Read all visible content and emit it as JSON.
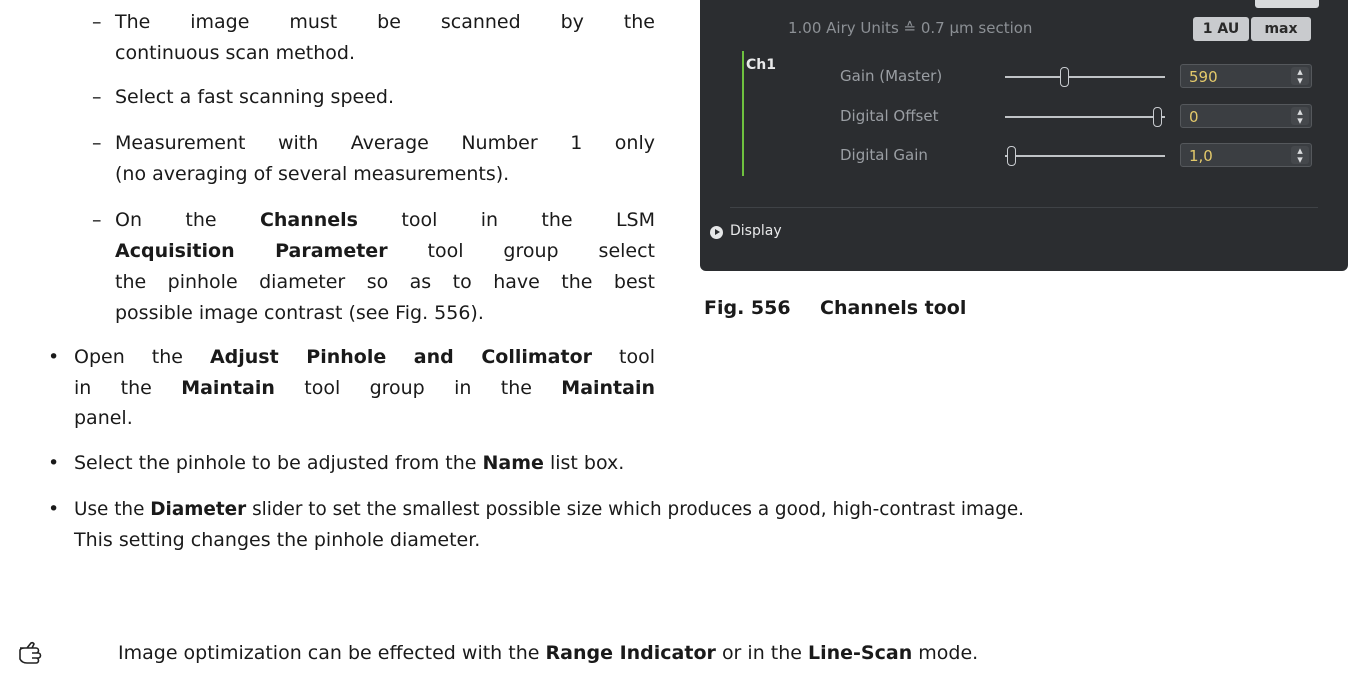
{
  "left_list": {
    "item1_line1": "The image must be scanned by the",
    "item1_line2": "continuous scan method.",
    "item2": "Select a fast scanning speed.",
    "item3_line1": "Measurement with Average Number 1 only",
    "item3_line2": "(no averaging of several measurements).",
    "item4_line1_pre": "On the",
    "item4_line1_bold": "Channels",
    "item4_line1_post": "tool in the LSM",
    "item4_line2_bold": "Acquisition Parameter",
    "item4_line2_post": "tool group select",
    "item4_line3": "the pinhole diameter so as to have the best",
    "item4_line4": "possible image contrast (see Fig. 556).",
    "item5_line1_pre": "Open the",
    "item5_line1_bold": "Adjust Pinhole and Collimator",
    "item5_line1_post": "tool",
    "item5_line2_a": "in the",
    "item5_line2_b": "Maintain",
    "item5_line2_c": "tool group in the",
    "item5_line2_d": "Maintain",
    "item5_line3": "panel."
  },
  "bottom": {
    "b1_pre": "Select the pinhole to be adjusted from the",
    "b1_bold": "Name",
    "b1_post": "list box.",
    "b2_pre": "Use the",
    "b2_bold": "Diameter",
    "b2_post": "slider to set the smallest possible size which produces a good, high-contrast image.",
    "b2_line2": "This setting changes the pinhole diameter.",
    "note_pre": "Image optimization can be effected with the",
    "note_bold1": "Range Indicator",
    "note_mid": "or in the",
    "note_bold2": "Line-Scan",
    "note_post": "mode."
  },
  "panel": {
    "airy_text": "1.00 Airy Units  ≙  0.7 µm section",
    "btn_1au": "1 AU",
    "btn_max": "max",
    "channel": "Ch1",
    "gain_label": "Gain (Master)",
    "gain_value": "590",
    "offset_label": "Digital Offset",
    "offset_value": "0",
    "dgain_label": "Digital Gain",
    "dgain_value": "1,0",
    "display_label": "Display",
    "slider_levels": {
      "gain_master": 0.37,
      "digital_offset": 0.95,
      "digital_gain": 0.04
    }
  },
  "figure": {
    "number": "Fig. 556",
    "title": "Channels tool"
  },
  "colors": {
    "panel_bg": "#2b2d30",
    "value_text": "#e3c96b",
    "channel_bar": "#6ec13f"
  },
  "icons": {
    "note": "pointing-hand-icon",
    "display": "expand-arrow-icon"
  }
}
